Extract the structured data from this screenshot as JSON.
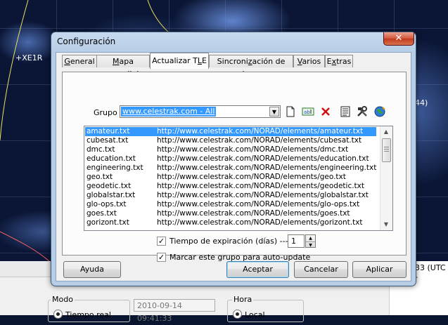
{
  "background": {
    "satellite_label": "+XE1R",
    "right_edge_text": "44)",
    "right_edge_bottom_text": "33 (UTC -",
    "modo_title": "Modo",
    "modo_option": "Tiempo real",
    "hora_title": "Hora",
    "hora_option": "Local",
    "datetime_value": "2010-09-14 09:41:33"
  },
  "dialog": {
    "title": "Configuración",
    "close_label": "✕",
    "tabs": [
      {
        "label": "General",
        "key": "G"
      },
      {
        "label": "Mapa mundial",
        "key": "M"
      },
      {
        "label": "Actualizar TLE",
        "key": "L"
      },
      {
        "label": "Sincronización de hora",
        "key": "z"
      },
      {
        "label": "Varios",
        "key": "V"
      },
      {
        "label": "Extras",
        "key": "x"
      }
    ],
    "group_label": "Grupo",
    "group_value": "www.celestrak.com - All",
    "tle_files": [
      {
        "name": "amateur.txt",
        "url": "http://www.celestrak.com/NORAD/elements/amateur.txt"
      },
      {
        "name": "cubesat.txt",
        "url": "http://www.celestrak.com/NORAD/elements/cubesat.txt"
      },
      {
        "name": "dmc.txt",
        "url": "http://www.celestrak.com/NORAD/elements/dmc.txt"
      },
      {
        "name": "education.txt",
        "url": "http://www.celestrak.com/NORAD/elements/education.txt"
      },
      {
        "name": "engineering.txt",
        "url": "http://www.celestrak.com/NORAD/elements/engineering.txt"
      },
      {
        "name": "geo.txt",
        "url": "http://www.celestrak.com/NORAD/elements/geo.txt"
      },
      {
        "name": "geodetic.txt",
        "url": "http://www.celestrak.com/NORAD/elements/geodetic.txt"
      },
      {
        "name": "globalstar.txt",
        "url": "http://www.celestrak.com/NORAD/elements/globalstar.txt"
      },
      {
        "name": "glo-ops.txt",
        "url": "http://www.celestrak.com/NORAD/elements/glo-ops.txt"
      },
      {
        "name": "goes.txt",
        "url": "http://www.celestrak.com/NORAD/elements/goes.txt"
      },
      {
        "name": "gorizont.txt",
        "url": "http://www.celestrak.com/NORAD/elements/gorizont.txt"
      }
    ],
    "expiration_label": "Tiempo de expiración (días) --->",
    "expiration_value": "1",
    "autoupdate_label": "Marcar este grupo para auto-update",
    "buttons": {
      "help": "Ayuda",
      "accept": "Aceptar",
      "cancel": "Cancelar",
      "apply": "Aplicar"
    },
    "colors": {
      "selection": "#3399ff",
      "title_bar": "#b7cde6",
      "close": "#c0391c"
    }
  }
}
